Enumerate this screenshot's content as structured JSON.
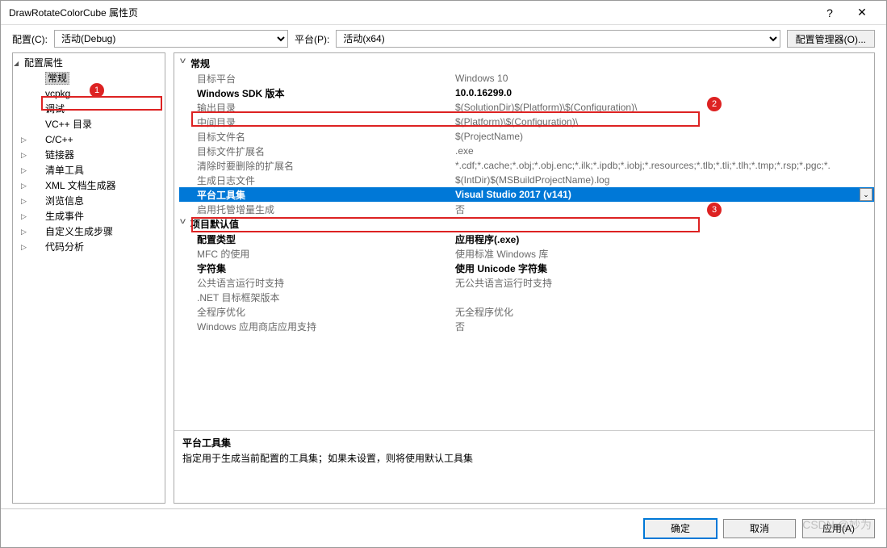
{
  "title": "DrawRotateColorCube 属性页",
  "toprow": {
    "config_label": "配置(C):",
    "config_value": "活动(Debug)",
    "platform_label": "平台(P):",
    "platform_value": "活动(x64)",
    "cfg_mgr": "配置管理器(O)..."
  },
  "tree": {
    "root": "配置属性",
    "items": [
      "常规",
      "vcpkg",
      "调试",
      "VC++ 目录",
      "C/C++",
      "链接器",
      "清单工具",
      "XML 文档生成器",
      "浏览信息",
      "生成事件",
      "自定义生成步骤",
      "代码分析"
    ]
  },
  "groups": [
    {
      "title": "常规",
      "rows": [
        {
          "k": "目标平台",
          "v": "Windows 10"
        },
        {
          "k": "Windows SDK 版本",
          "v": "10.0.16299.0",
          "bold": true
        },
        {
          "k": "输出目录",
          "v": "$(SolutionDir)$(Platform)\\$(Configuration)\\"
        },
        {
          "k": "中间目录",
          "v": "$(Platform)\\$(Configuration)\\"
        },
        {
          "k": "目标文件名",
          "v": "$(ProjectName)"
        },
        {
          "k": "目标文件扩展名",
          "v": ".exe"
        },
        {
          "k": "清除时要删除的扩展名",
          "v": "*.cdf;*.cache;*.obj;*.obj.enc;*.ilk;*.ipdb;*.iobj;*.resources;*.tlb;*.tli;*.tlh;*.tmp;*.rsp;*.pgc;*."
        },
        {
          "k": "生成日志文件",
          "v": "$(IntDir)$(MSBuildProjectName).log"
        },
        {
          "k": "平台工具集",
          "v": "Visual Studio 2017 (v141)",
          "bold": true,
          "sel": true
        },
        {
          "k": "启用托管增量生成",
          "v": "否"
        }
      ]
    },
    {
      "title": "项目默认值",
      "rows": [
        {
          "k": "配置类型",
          "v": "应用程序(.exe)",
          "bold": true
        },
        {
          "k": "MFC 的使用",
          "v": "使用标准 Windows 库"
        },
        {
          "k": "字符集",
          "v": "使用 Unicode 字符集",
          "bold": true
        },
        {
          "k": "公共语言运行时支持",
          "v": "无公共语言运行时支持"
        },
        {
          "k": ".NET 目标框架版本",
          "v": ""
        },
        {
          "k": "全程序优化",
          "v": "无全程序优化"
        },
        {
          "k": "Windows 应用商店应用支持",
          "v": "否"
        }
      ]
    }
  ],
  "desc": {
    "title": "平台工具集",
    "text": "指定用于生成当前配置的工具集；如果未设置，则将使用默认工具集"
  },
  "buttons": {
    "ok": "确定",
    "cancel": "取消",
    "apply": "应用(A)"
  },
  "annotations": {
    "n1": "1",
    "n2": "2",
    "n3": "3"
  },
  "watermark": "CSDN @妙为"
}
